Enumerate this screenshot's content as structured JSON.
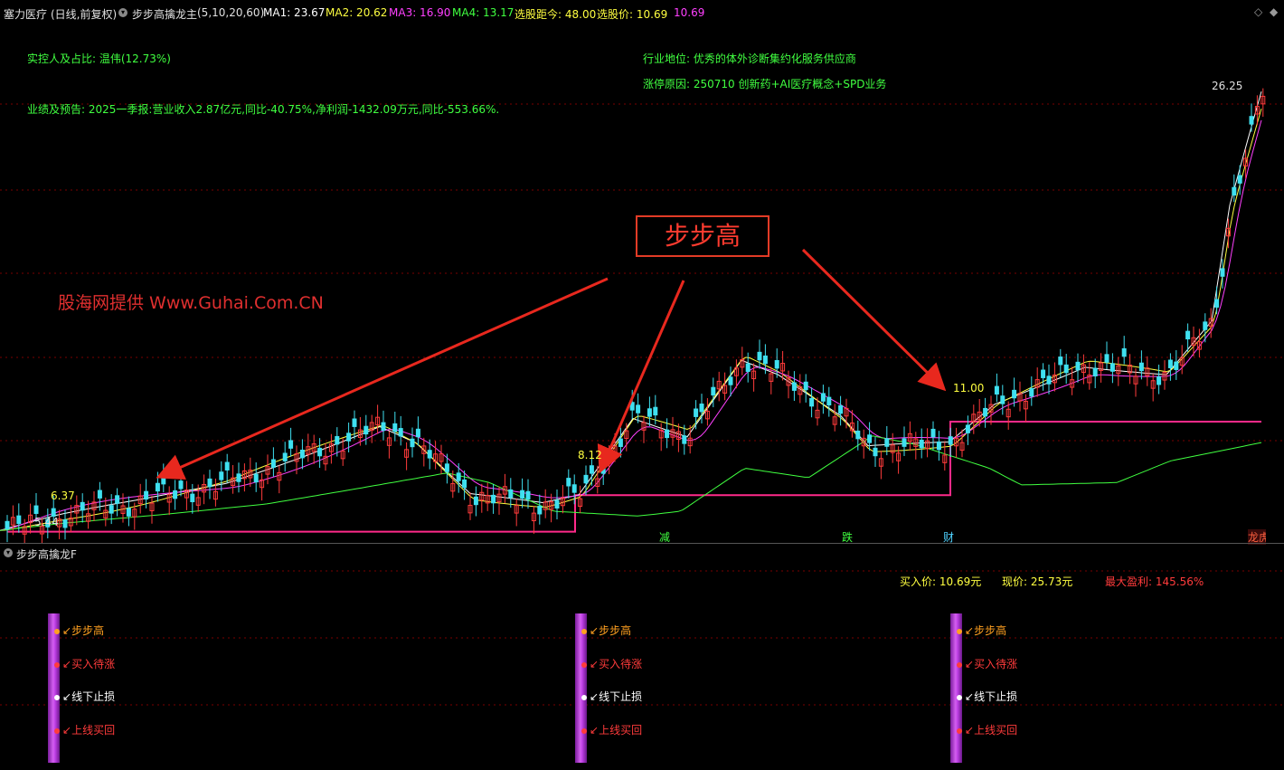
{
  "header": {
    "stock_name": "塞力医疗",
    "period": "(日线,前复权)",
    "indicator_name": "步步高擒龙主",
    "indicator_params": "(5,10,20,60)",
    "ma1": "MA1: 23.67",
    "ma2": "MA2: 20.62",
    "ma3": "MA3: 16.90",
    "ma4": "MA4: 13.17",
    "pick_distance": "选股距今: 48.00",
    "pick_price_label": "选股价: 10.69",
    "pick_price_extra": "10.69"
  },
  "info": {
    "controller": "实控人及占比: 温伟(12.73%)",
    "industry": "行业地位: 优秀的体外诊断集约化服务供应商",
    "limit_reason": "涨停原因: 250710 创新药+AI医疗概念+SPD业务",
    "performance": "业绩及预告: 2025一季报:营业收入2.87亿元,同比-40.75%,净利润-1432.09万元,同比-553.66%."
  },
  "watermark": "股海网提供 Www.Guhai.Com.CN",
  "annotation_box": "步步高",
  "price_labels": {
    "high": "26.25",
    "low": "5.44",
    "p1": "6.37",
    "p2": "8.12",
    "p3": "11.00"
  },
  "event_badges": [
    "减",
    "跌",
    "财",
    "龙虎榜"
  ],
  "sub_panel": {
    "title": "步步高擒龙F",
    "buy_price": "买入价: 10.69元",
    "current_price": "现价: 25.73元",
    "max_profit": "最大盈利: 145.56%",
    "signal_groups": [
      {
        "labels": [
          "步步高",
          "买入待涨",
          "线下止损",
          "上线买回"
        ]
      },
      {
        "labels": [
          "步步高",
          "买入待涨",
          "线下止损",
          "上线买回"
        ]
      },
      {
        "labels": [
          "步步高",
          "买入待涨",
          "线下止损",
          "上线买回"
        ]
      }
    ]
  },
  "colors": {
    "up": "#ff3b3b",
    "down": "#3fe0f0",
    "ma1": "#ffffff",
    "ma2": "#ffff40",
    "ma3": "#ff40ff",
    "ma4": "#40ff40",
    "support_line": "#ff2a8a",
    "arrow": "#e8281e"
  },
  "chart_data": {
    "type": "candlestick",
    "price_high": 26.25,
    "price_low": 5.44,
    "support_levels": [
      5.44,
      6.37,
      8.12,
      11.0
    ],
    "support_segments": [
      {
        "level": 5.44
      },
      {
        "level": 6.37
      },
      {
        "level": 8.12
      },
      {
        "level": 11.0
      }
    ]
  }
}
